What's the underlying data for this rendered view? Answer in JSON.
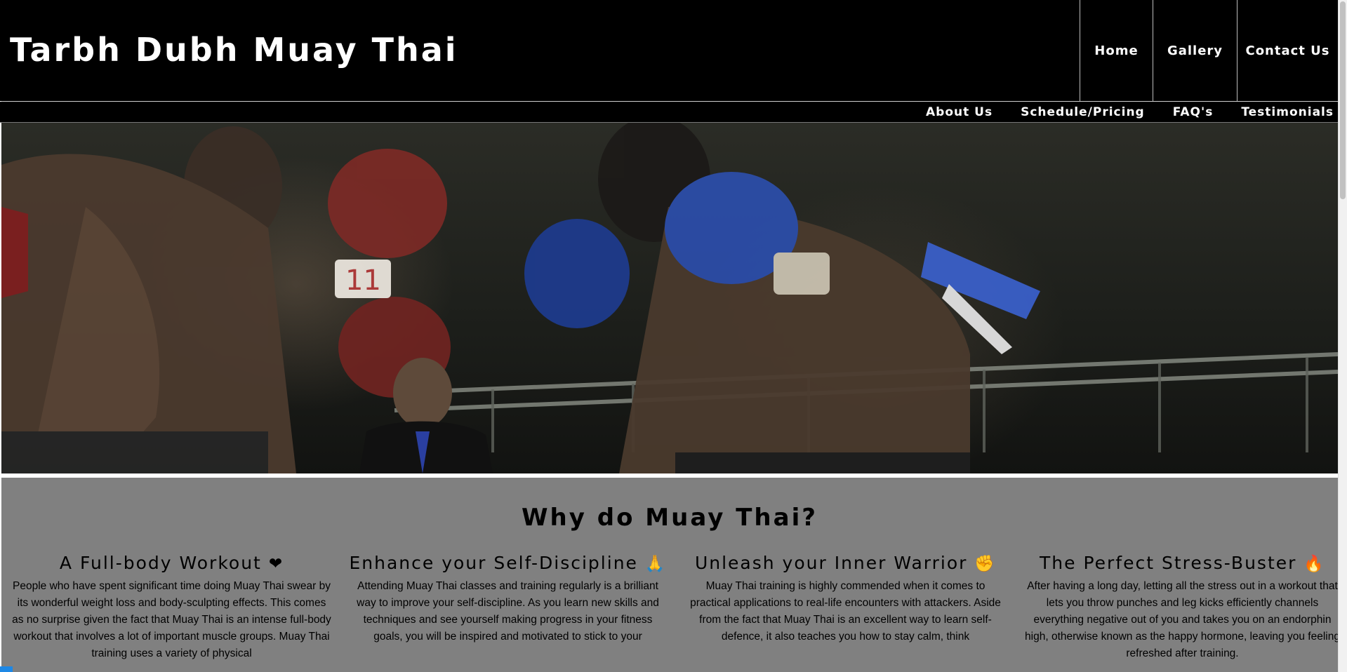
{
  "header": {
    "logo": "Tarbh Dubh Muay Thai",
    "primary_nav": [
      "Home",
      "Gallery",
      "Contact Us"
    ],
    "secondary_nav": [
      "About Us",
      "Schedule/Pricing",
      "FAQ's",
      "Testimonials"
    ]
  },
  "hero": {
    "image_semantic": "muay-thai-fight-photo",
    "corner_number": "11"
  },
  "why": {
    "title": "Why do Muay Thai?",
    "cards": [
      {
        "title": "A Full-body Workout",
        "icon": "❤",
        "icon_name": "heartbeat-icon",
        "text": "People who have spent significant time doing Muay Thai swear by its wonderful weight loss and body-sculpting effects. This comes as no surprise given the fact that Muay Thai is an intense full-body workout that involves a lot of important muscle groups. Muay Thai training uses a variety of physical"
      },
      {
        "title": "Enhance your Self-Discipline",
        "icon": "🙏",
        "icon_name": "praying-hands-icon",
        "text": "Attending Muay Thai classes and training regularly is a brilliant way to improve your self-discipline. As you learn new skills and techniques and see yourself making progress in your fitness goals, you will be inspired and motivated to stick to your"
      },
      {
        "title": "Unleash your Inner Warrior",
        "icon": "✊",
        "icon_name": "fist-icon",
        "text": "Muay Thai training is highly commended when it comes to practical applications to real-life encounters with attackers. Aside from the fact that Muay Thai is an excellent way to learn self-defence, it also teaches you how to stay calm, think"
      },
      {
        "title": "The Perfect Stress-Buster",
        "icon": "🔥",
        "icon_name": "fire-icon",
        "text": "After having a long day, letting all the stress out in a workout that lets you throw punches and leg kicks efficiently channels everything negative out of you and takes you on an endorphin high, otherwise known as the happy hormone, leaving you feeling refreshed after training."
      }
    ]
  },
  "colors": {
    "header_bg": "#000000",
    "section_bg": "#808080",
    "text": "#000000",
    "nav_text": "#ffffff"
  }
}
